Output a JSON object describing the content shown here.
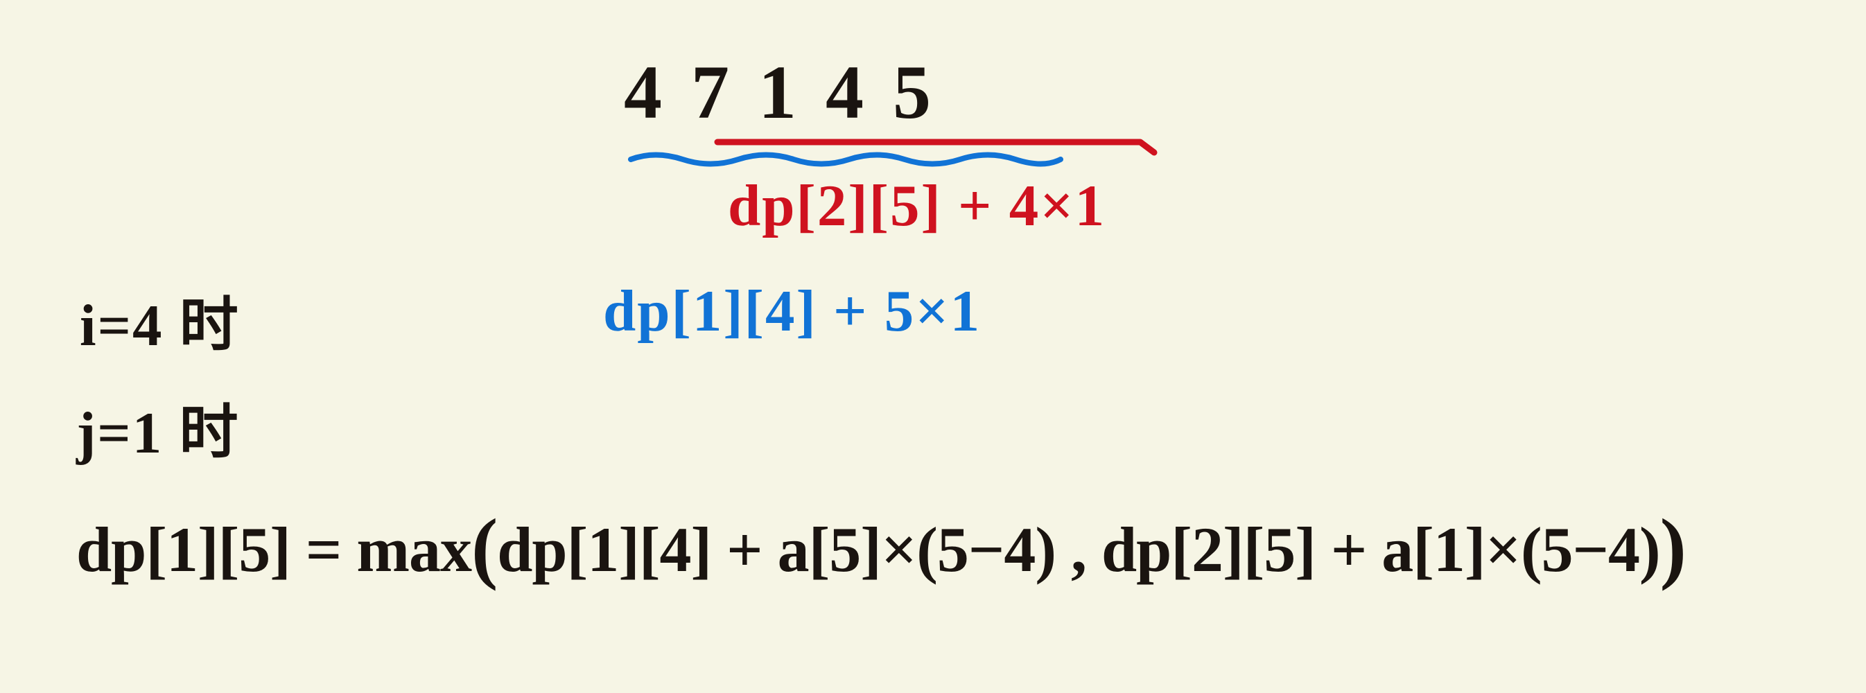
{
  "sequence": [
    "4",
    "7",
    "1",
    "4",
    "5"
  ],
  "annotation_red": "dp[2][5] + 4×1",
  "annotation_blue": "dp[1][4] + 5×1",
  "i_line": "i=4 时",
  "j_line": "j=1 时",
  "equation": {
    "lhs": "dp[1][5]",
    "eq": " = ",
    "fn": "max",
    "open": "(",
    "arg1": "dp[1][4] + a[5]×(5−4)",
    "comma": " , ",
    "arg2": "dp[2][5] + a[1]×(5−4)",
    "close": ")"
  }
}
